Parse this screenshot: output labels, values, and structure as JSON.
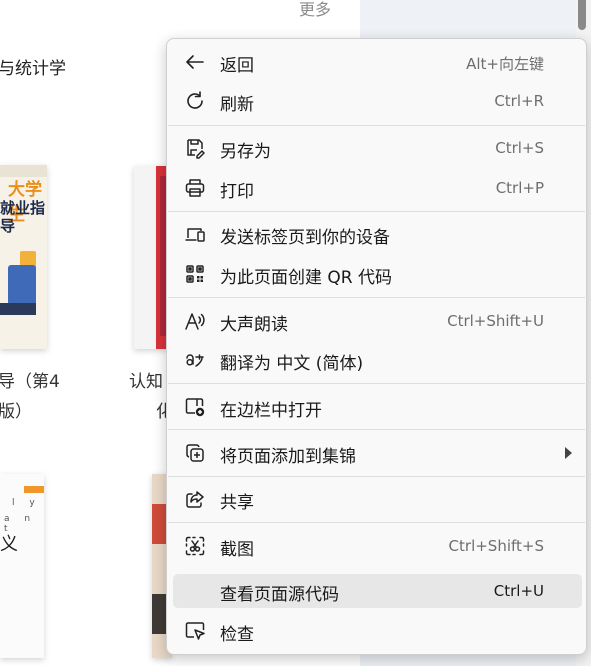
{
  "background": {
    "more_link": "更多",
    "category_text": "与统计学",
    "book1_cover_line1": "大学生",
    "book1_cover_line2": "就业指导",
    "book3_cover_line1": "l y",
    "book3_cover_line2": "a n t",
    "book3_cover_line3": "义",
    "title_left_line1": "导（第4",
    "title_left_line2": "版）",
    "title_right_line1": "认知",
    "title_right_line2": "化"
  },
  "menu": {
    "items": [
      {
        "label": "返回",
        "shortcut": "Alt+向左键",
        "icon": "back-arrow-icon"
      },
      {
        "label": "刷新",
        "shortcut": "Ctrl+R",
        "icon": "refresh-icon"
      },
      {
        "label": "另存为",
        "shortcut": "Ctrl+S",
        "icon": "save-as-icon"
      },
      {
        "label": "打印",
        "shortcut": "Ctrl+P",
        "icon": "print-icon"
      },
      {
        "label": "发送标签页到你的设备",
        "shortcut": "",
        "icon": "send-to-device-icon"
      },
      {
        "label": "为此页面创建 QR 代码",
        "shortcut": "",
        "icon": "qr-code-icon"
      },
      {
        "label": "大声朗读",
        "shortcut": "Ctrl+Shift+U",
        "icon": "read-aloud-icon"
      },
      {
        "label": "翻译为 中文 (简体)",
        "shortcut": "",
        "icon": "translate-icon"
      },
      {
        "label": "在边栏中打开",
        "shortcut": "",
        "icon": "sidebar-open-icon"
      },
      {
        "label": "将页面添加到集锦",
        "shortcut": "",
        "icon": "collections-add-icon"
      },
      {
        "label": "共享",
        "shortcut": "",
        "icon": "share-icon"
      },
      {
        "label": "截图",
        "shortcut": "Ctrl+Shift+S",
        "icon": "screenshot-icon"
      },
      {
        "label": "查看页面源代码",
        "shortcut": "Ctrl+U",
        "icon": ""
      },
      {
        "label": "检查",
        "shortcut": "",
        "icon": "inspect-icon"
      }
    ]
  }
}
